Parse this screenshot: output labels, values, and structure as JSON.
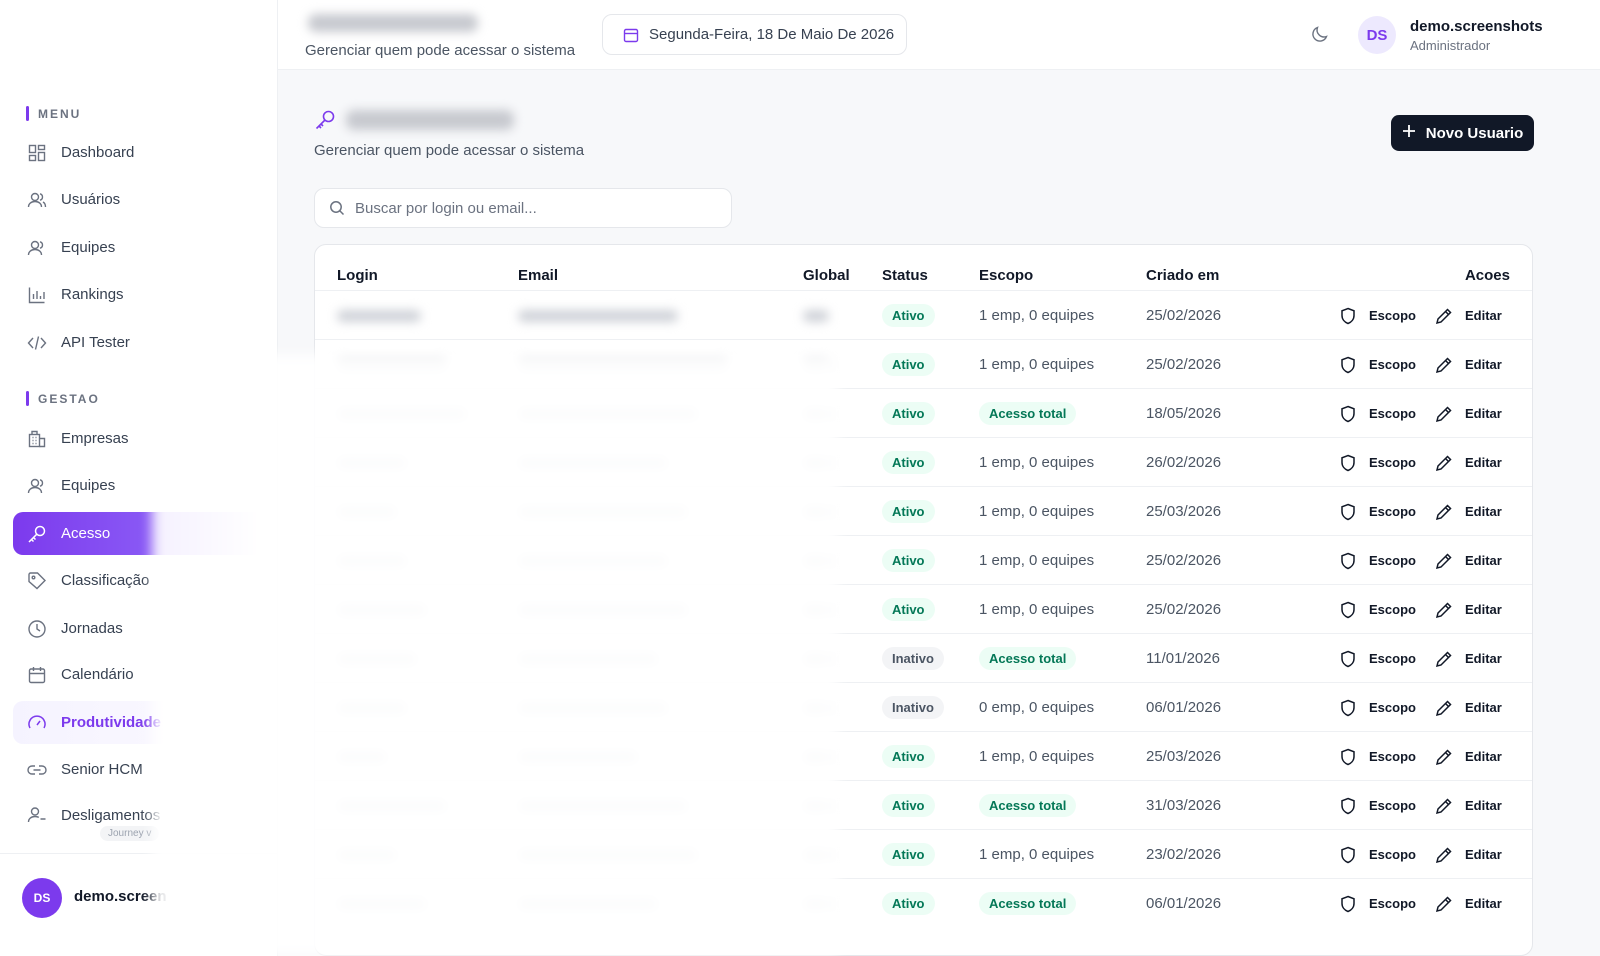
{
  "header": {
    "subtitle": "Gerenciar quem pode acessar o sistema",
    "date": "Segunda-Feira, 18 De Maio De 2026",
    "user": {
      "initials": "DS",
      "name": "demo.screenshots",
      "role": "Administrador"
    }
  },
  "sidebar": {
    "menu_label": "MENU",
    "menu_items": [
      {
        "label": "Dashboard",
        "icon": "dashboard-icon"
      },
      {
        "label": "Usuários",
        "icon": "users-icon"
      },
      {
        "label": "Equipes",
        "icon": "team-icon"
      },
      {
        "label": "Rankings",
        "icon": "chart-icon"
      },
      {
        "label": "API Tester",
        "icon": "code-icon"
      }
    ],
    "gestao_label": "GESTAO",
    "gestao_items": [
      {
        "label": "Empresas",
        "icon": "building-icon"
      },
      {
        "label": "Equipes",
        "icon": "team-icon"
      },
      {
        "label": "Acesso",
        "icon": "key-icon",
        "state": "active"
      },
      {
        "label": "Classificação",
        "icon": "tag-icon"
      },
      {
        "label": "Jornadas",
        "icon": "clock-icon"
      },
      {
        "label": "Calendário",
        "icon": "calendar-icon"
      },
      {
        "label": "Produtividade",
        "icon": "gauge-icon",
        "state": "highlighted"
      },
      {
        "label": "Senior HCM",
        "icon": "link-icon"
      },
      {
        "label": "Desligamentos",
        "icon": "user-minus-icon"
      }
    ],
    "journey_tag": "Journey v",
    "footer_user": {
      "initials": "DS",
      "name": "demo.screen"
    }
  },
  "main": {
    "subtitle": "Gerenciar quem pode acessar o sistema",
    "new_button": "Novo Usuario",
    "search_placeholder": "Buscar por login ou email..."
  },
  "table": {
    "columns": [
      "Login",
      "Email",
      "Global",
      "Status",
      "Escopo",
      "Criado em",
      "Acoes"
    ],
    "action_scope": "Escopo",
    "action_edit": "Editar",
    "rows": [
      {
        "status": "Ativo",
        "escopo": "1 emp, 0 equipes",
        "criado": "25/02/2026"
      },
      {
        "status": "Ativo",
        "escopo": "1 emp, 0 equipes",
        "criado": "25/02/2026"
      },
      {
        "status": "Ativo",
        "escopo": "Acesso total",
        "criado": "18/05/2026"
      },
      {
        "status": "Ativo",
        "escopo": "1 emp, 0 equipes",
        "criado": "26/02/2026"
      },
      {
        "status": "Ativo",
        "escopo": "1 emp, 0 equipes",
        "criado": "25/03/2026"
      },
      {
        "status": "Ativo",
        "escopo": "1 emp, 0 equipes",
        "criado": "25/02/2026"
      },
      {
        "status": "Ativo",
        "escopo": "1 emp, 0 equipes",
        "criado": "25/02/2026"
      },
      {
        "status": "Inativo",
        "escopo": "Acesso total",
        "criado": "11/01/2026"
      },
      {
        "status": "Inativo",
        "escopo": "0 emp, 0 equipes",
        "criado": "06/01/2026"
      },
      {
        "status": "Ativo",
        "escopo": "1 emp, 0 equipes",
        "criado": "25/03/2026"
      },
      {
        "status": "Ativo",
        "escopo": "Acesso total",
        "criado": "31/03/2026"
      },
      {
        "status": "Ativo",
        "escopo": "1 emp, 0 equipes",
        "criado": "23/02/2026"
      },
      {
        "status": "Ativo",
        "escopo": "Acesso total",
        "criado": "06/01/2026"
      }
    ]
  }
}
